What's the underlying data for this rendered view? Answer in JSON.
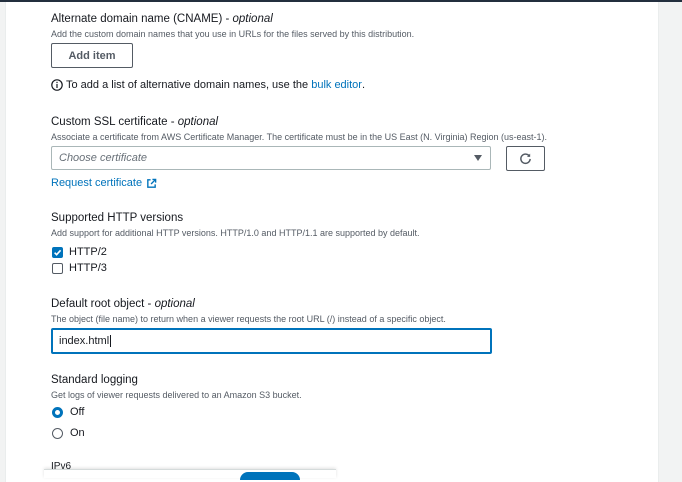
{
  "cname": {
    "label": "Alternate domain name (CNAME) - ",
    "optional": "optional",
    "description": "Add the custom domain names that you use in URLs for the files served by this distribution.",
    "add_item": "Add item",
    "info_prefix": "To add a list of alternative domain names, use the ",
    "info_link": "bulk editor",
    "info_suffix": "."
  },
  "ssl": {
    "label": "Custom SSL certificate - ",
    "optional": "optional",
    "description": "Associate a certificate from AWS Certificate Manager. The certificate must be in the US East (N. Virginia) Region (us-east-1).",
    "select_placeholder": "Choose certificate",
    "request_link": "Request certificate"
  },
  "http": {
    "label": "Supported HTTP versions",
    "description": "Add support for additional HTTP versions. HTTP/1.0 and HTTP/1.1 are supported by default.",
    "options": [
      {
        "label": "HTTP/2",
        "checked": true
      },
      {
        "label": "HTTP/3",
        "checked": false
      }
    ]
  },
  "root": {
    "label": "Default root object - ",
    "optional": "optional",
    "description": "The object (file name) to return when a viewer requests the root URL (/) instead of a specific object.",
    "value": "index.html"
  },
  "logging": {
    "label": "Standard logging",
    "description": "Get logs of viewer requests delivered to an Amazon S3 bucket.",
    "options": [
      {
        "label": "Off",
        "selected": true
      },
      {
        "label": "On",
        "selected": false
      }
    ]
  },
  "ipv6": {
    "label": "IPv6"
  },
  "colors": {
    "accent": "#0073bb",
    "text": "#16191f",
    "muted": "#545b64"
  }
}
